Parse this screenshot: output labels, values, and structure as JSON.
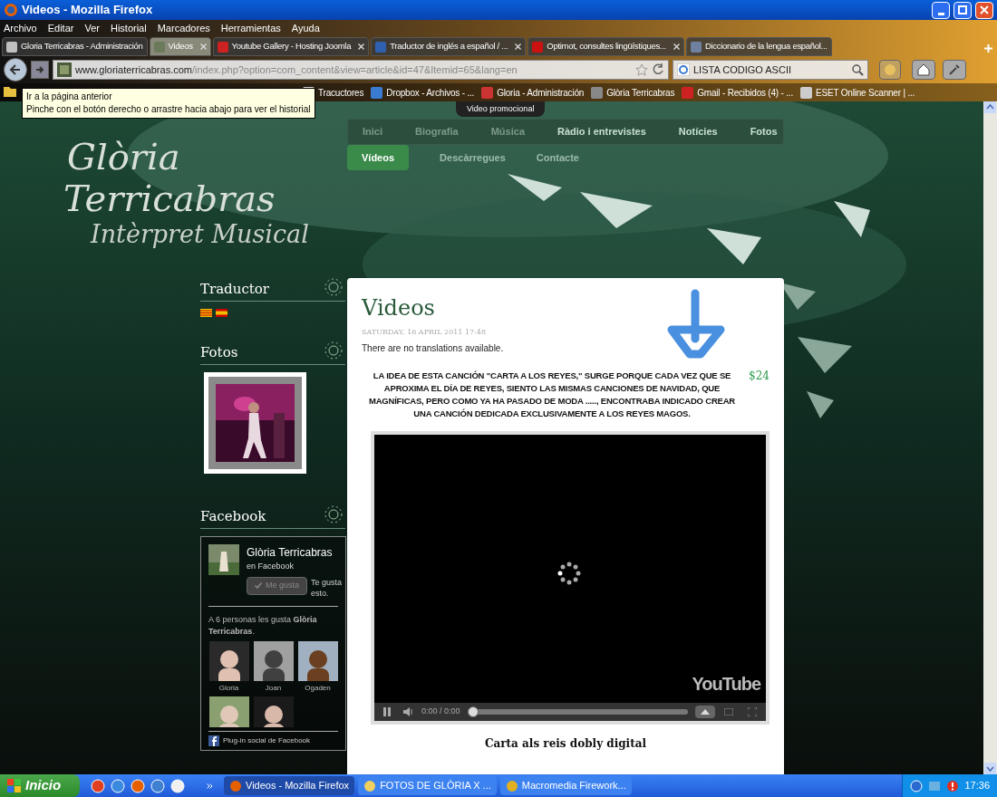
{
  "window": {
    "title": "Videos - Mozilla Firefox"
  },
  "menu": [
    "Archivo",
    "Editar",
    "Ver",
    "Historial",
    "Marcadores",
    "Herramientas",
    "Ayuda"
  ],
  "tabs": [
    {
      "label": "Gloria Terricabras - Administración",
      "selected": false,
      "closable": false
    },
    {
      "label": "Videos",
      "selected": true,
      "closable": true
    },
    {
      "label": "Youtube Gallery - Hosting Joomla",
      "selected": false,
      "closable": true
    },
    {
      "label": "Traductor de inglés a español / ...",
      "selected": false,
      "closable": true
    },
    {
      "label": "Optimot, consultes lingüístiques...",
      "selected": false,
      "closable": true
    },
    {
      "label": "Diccionario de la lengua español...",
      "selected": false,
      "closable": false
    }
  ],
  "address": {
    "domain": "www.gloriaterricabras.com",
    "path": "/index.php?option=com_content&view=article&id=47&Itemid=65&lang=en"
  },
  "search": {
    "value": "LISTA CODIGO ASCII"
  },
  "bookmarks": [
    "Tracuctores",
    "Dropbox - Archivos - ...",
    "Gloria - Administración",
    "Glòria Terricabras",
    "Gmail - Recibidos (4) - ...",
    "ESET Online Scanner | ..."
  ],
  "tooltip": {
    "lines": [
      "Ir a la página anterior",
      "Pinche con el botón derecho o arrastre hacia abajo para ver el historial"
    ]
  },
  "site": {
    "promo_tab": "Video promocional",
    "logo": [
      "Glòria",
      "Terricabras",
      "Intèrpret Musical"
    ],
    "nav": [
      [
        {
          "label": "Inici",
          "selected": false
        },
        {
          "label": "Biografia",
          "selected": false
        },
        {
          "label": "Música",
          "selected": false
        },
        {
          "label": "Ràdio i entrevistes",
          "selected": false
        },
        {
          "label": "Notícies",
          "selected": false
        },
        {
          "label": "Fotos",
          "selected": false
        }
      ],
      [
        {
          "label": "Vídeos",
          "selected": true
        },
        {
          "label": "Descàrregues",
          "selected": false
        },
        {
          "label": "Contacte",
          "selected": false
        }
      ]
    ]
  },
  "sidebar": {
    "translator_title": "Traductor",
    "photos_title": "Fotos",
    "facebook_title": "Facebook",
    "facebook": {
      "page_name": "Glòria Terricabras",
      "subtitle": "en Facebook",
      "like_button": "Me gusta",
      "like_note": "Te gusta esto.",
      "fans_text": "A 6 personas les gusta **Glòria Terricabras**.",
      "fans": [
        {
          "name": "Gloria"
        },
        {
          "name": "Joan"
        },
        {
          "name": "Ogaden"
        },
        {
          "kind": "picture"
        },
        {
          "kind": "picture"
        }
      ],
      "footer": "Plug-in social de Facebook"
    }
  },
  "article": {
    "title": "Videos",
    "date": "SATURDAY, 16 APRIL 2011 17:48",
    "note": "There are no translations available.",
    "body": "LA IDEA DE ESTA CANCIÓN \"CARTA A LOS REYES,\" SURGE PORQUE CADA VEZ QUE SE APROXIMA EL DÍA DE REYES, SIENTO LAS MISMAS CANCIONES DE NAVIDAD, QUE MAGNÍFICAS, PERO COMO YA HA PASADO DE MODA ....., ENCONTRABA INDICADO CREAR UNA CANCIÓN DEDICADA EXCLUSIVAMENTE A LOS REYES MAGOS.",
    "ad_price": "$24",
    "video": {
      "time": "0:00 / 0:00",
      "level": 0,
      "brand": "YouTube"
    },
    "caption": "Carta als reis dobly digital"
  },
  "taskbar": {
    "start": "Inicio",
    "tasks": [
      {
        "label": "Videos - Mozilla Firefox",
        "selected": true
      },
      {
        "label": "FOTOS DE GLÒRIA X ...",
        "selected": false
      },
      {
        "label": "Macromedia Firework...",
        "selected": false
      }
    ],
    "clock": "17:36"
  }
}
